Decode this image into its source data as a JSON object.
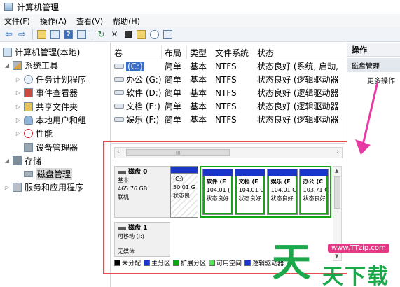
{
  "window": {
    "title": "计算机管理"
  },
  "menu": [
    "文件(F)",
    "操作(A)",
    "查看(V)",
    "帮助(H)"
  ],
  "toolbar": {
    "icons": [
      "back-arrow-icon",
      "forward-arrow-icon",
      "up-folder-icon",
      "show-tree-icon",
      "help-icon",
      "properties-icon",
      "refresh-icon",
      "delete-icon",
      "edit-icon",
      "folder-open-icon",
      "search-icon",
      "check-icon"
    ],
    "delete_glyph": "✕",
    "back_glyph": "⇦",
    "forward_glyph": "⇨",
    "help_glyph": "?",
    "refresh_glyph": "↻"
  },
  "tree": {
    "root": "计算机管理(本地)",
    "items": [
      {
        "label": "系统工具",
        "icon": "tools-icon"
      },
      {
        "label": "任务计划程序",
        "icon": "clock-icon"
      },
      {
        "label": "事件查看器",
        "icon": "event-viewer-icon"
      },
      {
        "label": "共享文件夹",
        "icon": "shared-folder-icon"
      },
      {
        "label": "本地用户和组",
        "icon": "users-icon"
      },
      {
        "label": "性能",
        "icon": "performance-icon"
      },
      {
        "label": "设备管理器",
        "icon": "device-manager-icon"
      },
      {
        "label": "存储",
        "icon": "storage-icon"
      },
      {
        "label": "磁盘管理",
        "icon": "disk-icon"
      },
      {
        "label": "服务和应用程序",
        "icon": "services-icon"
      }
    ],
    "collapsed_glyph": "▷",
    "expanded_glyph": "◢"
  },
  "volume_list": {
    "columns": [
      "卷",
      "布局",
      "类型",
      "文件系统",
      "状态"
    ],
    "rows": [
      {
        "name": "(C:)",
        "layout": "简单",
        "type": "基本",
        "fs": "NTFS",
        "status": "状态良好 (系统, 启动,"
      },
      {
        "name": "办公 (G:)",
        "layout": "简单",
        "type": "基本",
        "fs": "NTFS",
        "status": "状态良好 (逻辑驱动器"
      },
      {
        "name": "软件 (D:)",
        "layout": "简单",
        "type": "基本",
        "fs": "NTFS",
        "status": "状态良好 (逻辑驱动器"
      },
      {
        "name": "文档 (E:)",
        "layout": "简单",
        "type": "基本",
        "fs": "NTFS",
        "status": "状态良好 (逻辑驱动器"
      },
      {
        "name": "娱乐 (F:)",
        "layout": "简单",
        "type": "基本",
        "fs": "NTFS",
        "status": "状态良好 (逻辑驱动器"
      }
    ]
  },
  "disk_view": {
    "scroll_grip": "III",
    "left_arrow": "‹",
    "right_arrow": "›",
    "up_arrow": "▲",
    "down_arrow": "▼",
    "disk0": {
      "name": "磁盘 0",
      "type": "基本",
      "size": "465.76 GB",
      "state": "联机"
    },
    "disk1": {
      "name": "磁盘 1",
      "type": "可移动 (J:)",
      "media": "无媒体"
    },
    "partitions": [
      {
        "name": "(C:)",
        "size": "50.01 G",
        "status": "状态良"
      },
      {
        "name": "软件 (E",
        "size": "104.01 (",
        "status": "状态良好"
      },
      {
        "name": "文档 (E",
        "size": "104.01 C",
        "status": "状态良好"
      },
      {
        "name": "娱乐 (F",
        "size": "104.01 G",
        "status": "状态良好"
      },
      {
        "name": "办公 (C",
        "size": "103.71 C",
        "status": "状态良好"
      }
    ],
    "legend": [
      {
        "label": "未分配",
        "color": "#000000"
      },
      {
        "label": "主分区",
        "color": "#1a36c8"
      },
      {
        "label": "扩展分区",
        "color": "#12a412"
      },
      {
        "label": "可用空间",
        "color": "#54e354"
      },
      {
        "label": "逻辑驱动器",
        "color": "#1a36c8"
      }
    ]
  },
  "actions": {
    "header": "操作",
    "section": "磁盘管理",
    "more": "更多操作"
  },
  "watermark": {
    "url": "www.TTzip.com",
    "big": "天",
    "small": "天下载"
  },
  "colors": {
    "highlight_frame": "#e84b4b",
    "pointer_arrow": "#e63aa5",
    "watermark_green": "#19a84a"
  }
}
